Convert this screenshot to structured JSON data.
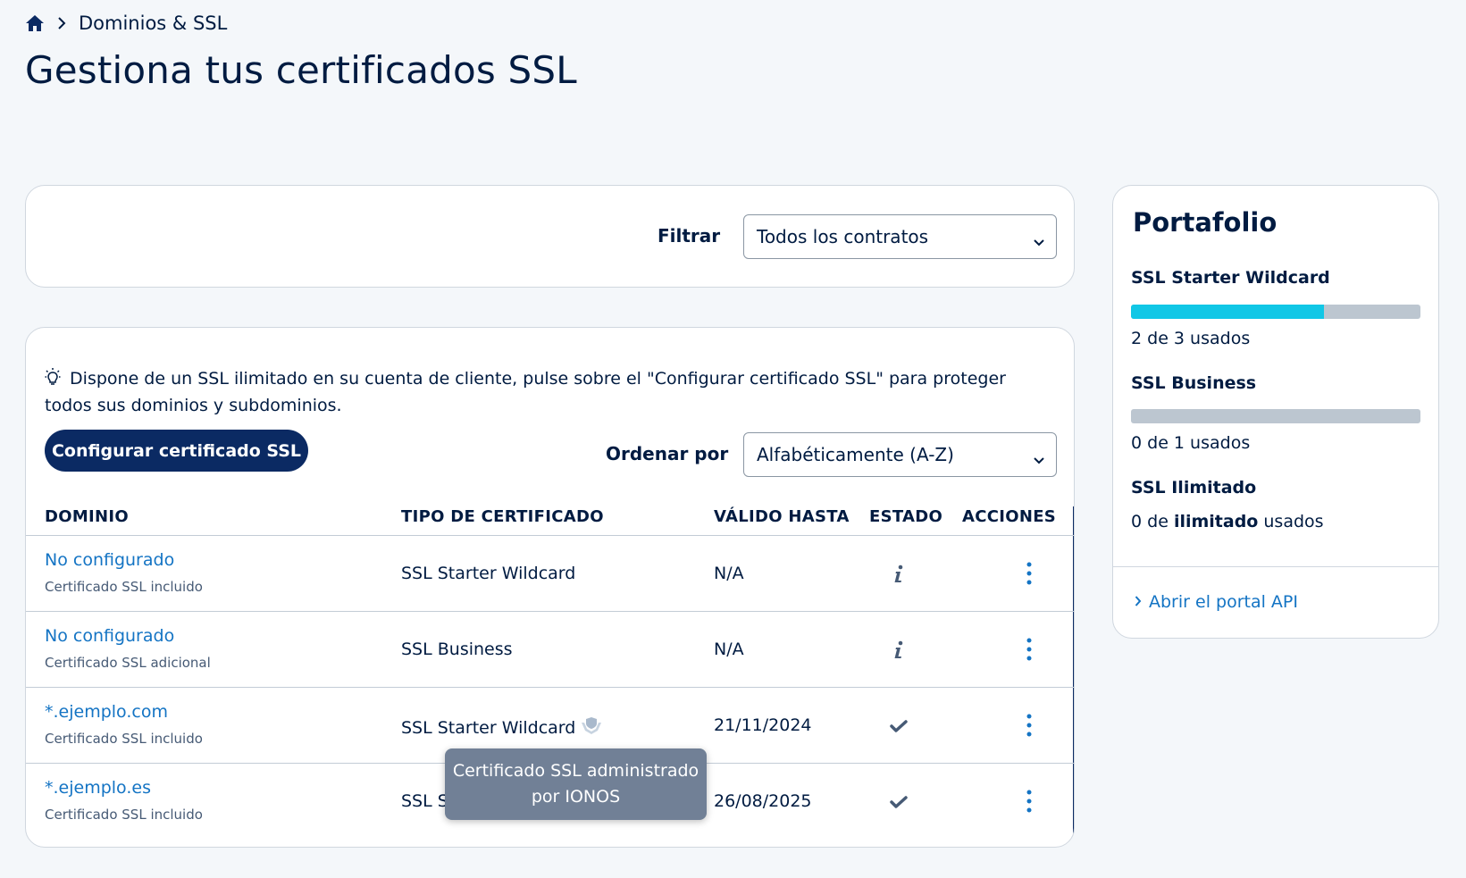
{
  "breadcrumb": {
    "home_icon": "home-icon",
    "current": "Dominios & SSL"
  },
  "page_title": "Gestiona tus certificados SSL",
  "filter": {
    "label": "Filtrar",
    "value": "Todos los contratos"
  },
  "tip": "Dispone de un SSL ilimitado en su cuenta de cliente, pulse sobre el \"Configurar certificado SSL\" para proteger todos sus dominios y subdominios.",
  "configure_button": "Configurar certificado SSL",
  "sort": {
    "label": "Ordenar por",
    "value": "Alfabéticamente (A-Z)"
  },
  "table": {
    "headers": {
      "domain": "DOMINIO",
      "type": "TIPO DE CERTIFICADO",
      "valid": "VÁLIDO HASTA",
      "state": "ESTADO",
      "actions": "ACCIONES"
    },
    "rows": [
      {
        "domain": "No configurado",
        "sub": "Certificado SSL incluido",
        "type": "SSL Starter Wildcard",
        "valid": "N/A",
        "state": "info-icon",
        "managed": false
      },
      {
        "domain": "No configurado",
        "sub": "Certificado SSL adicional",
        "type": "SSL Business",
        "valid": "N/A",
        "state": "info-icon",
        "managed": false
      },
      {
        "domain": "*.ejemplo.com",
        "sub": "Certificado SSL incluido",
        "type": "SSL Starter Wildcard",
        "valid": "21/11/2024",
        "state": "check-icon",
        "managed": true
      },
      {
        "domain": "*.ejemplo.es",
        "sub": "Certificado SSL incluido",
        "type": "SSL Starter Wildcard",
        "valid": "26/08/2025",
        "state": "check-icon",
        "managed": false
      }
    ]
  },
  "tooltip": {
    "line1": "Certificado SSL administrado",
    "line2": "por IONOS"
  },
  "portfolio": {
    "title": "Portafolio",
    "items": [
      {
        "name": "SSL Starter Wildcard",
        "usage": "2 de 3 usados",
        "used": 2,
        "total": 3
      },
      {
        "name": "SSL Business",
        "usage": "0 de 1 usados",
        "used": 0,
        "total": 1
      },
      {
        "name": "SSL Ilimitado",
        "usage_prefix": "0 de",
        "usage_bold": "ilimitado",
        "usage_suffix": "usados"
      }
    ],
    "api_link": "Abrir el portal API"
  },
  "colors": {
    "primary": "#0b2a63",
    "link": "#1474c4",
    "progress": "#11c7e6",
    "tooltip": "#718096"
  }
}
